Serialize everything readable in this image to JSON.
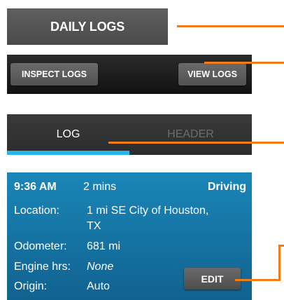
{
  "title_bar": {
    "label": "DAILY LOGS"
  },
  "toolbar": {
    "inspect_label": "INSPECT LOGS",
    "view_label": "VIEW LOGS"
  },
  "tabs": [
    {
      "label": "LOG",
      "selected": true
    },
    {
      "label": "HEADER",
      "selected": false
    }
  ],
  "card": {
    "time": "9:36 AM",
    "duration": "2 mins",
    "status": "Driving",
    "location_label": "Location:",
    "location_line1": "1 mi SE City of Houston,",
    "location_line2": "TX",
    "odometer_label": "Odometer:",
    "odometer_value": "681 mi",
    "engine_label": "Engine hrs:",
    "engine_value": "None",
    "origin_label": "Origin:",
    "origin_value": "Auto",
    "edit_label": "EDIT"
  },
  "colors": {
    "callout": "#f07d1a",
    "tab_indicator": "#27b7e8",
    "card_background": "#1a86b8"
  }
}
